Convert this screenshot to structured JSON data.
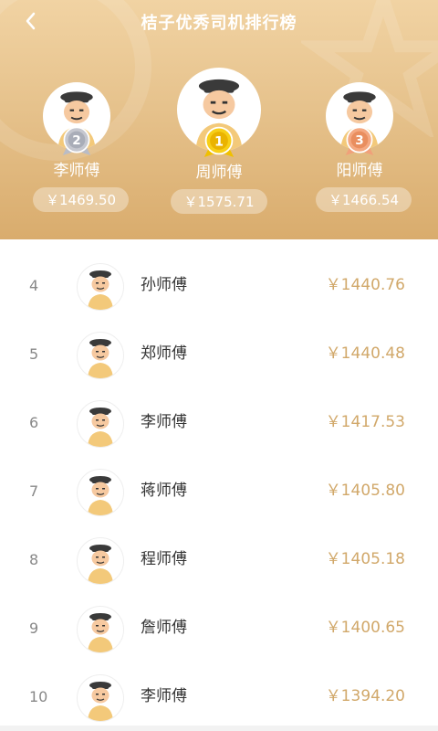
{
  "header": {
    "title": "桔子优秀司机排行榜",
    "back_icon": "chevron-left-icon",
    "colors": {
      "top": "#f1d3a3",
      "bottom": "#d9ac6d"
    }
  },
  "podium": [
    {
      "rank": "2",
      "name": "李师傅",
      "amount": "￥1469.50",
      "medal": "silver"
    },
    {
      "rank": "1",
      "name": "周师傅",
      "amount": "￥1575.71",
      "medal": "gold"
    },
    {
      "rank": "3",
      "name": "阳师傅",
      "amount": "￥1466.54",
      "medal": "bronze"
    }
  ],
  "list": [
    {
      "rank": "4",
      "name": "孙师傅",
      "amount": "￥1440.76"
    },
    {
      "rank": "5",
      "name": "郑师傅",
      "amount": "￥1440.48"
    },
    {
      "rank": "6",
      "name": "李师傅",
      "amount": "￥1417.53"
    },
    {
      "rank": "7",
      "name": "蒋师傅",
      "amount": "￥1405.80"
    },
    {
      "rank": "8",
      "name": "程师傅",
      "amount": "￥1405.18"
    },
    {
      "rank": "9",
      "name": "詹师傅",
      "amount": "￥1400.65"
    },
    {
      "rank": "10",
      "name": "李师傅",
      "amount": "￥1394.20"
    }
  ]
}
